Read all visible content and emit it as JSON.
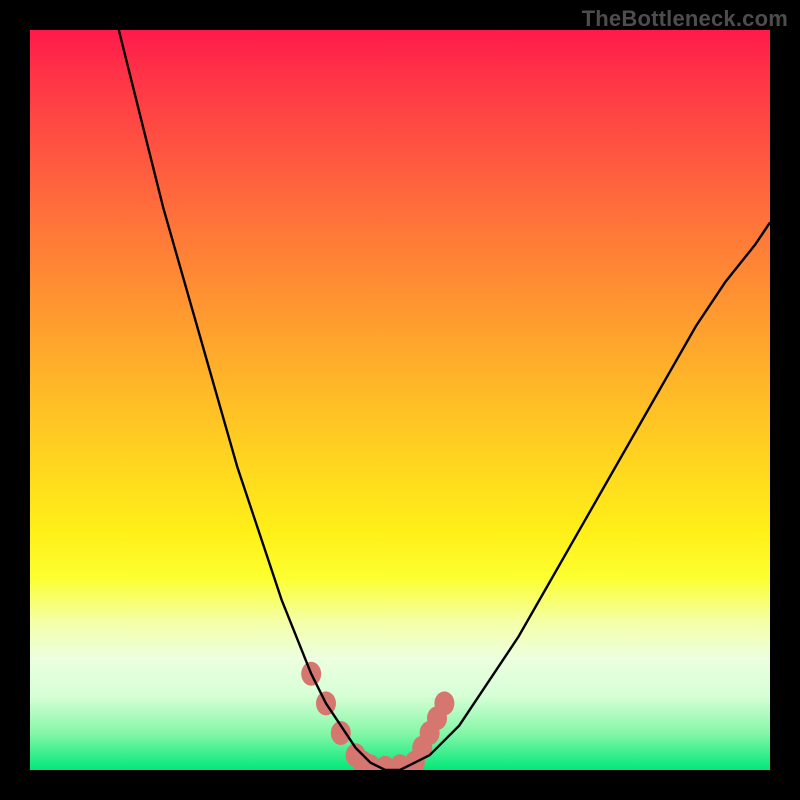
{
  "watermark": {
    "text": "TheBottleneck.com"
  },
  "colors": {
    "frame": "#000000",
    "gradient_top": "#ff1a4b",
    "gradient_mid": "#ffd420",
    "gradient_bottom": "#00e879",
    "curve": "#000000",
    "marker": "#d6776f"
  },
  "chart_data": {
    "type": "line",
    "title": "",
    "xlabel": "",
    "ylabel": "",
    "xlim": [
      0,
      100
    ],
    "ylim": [
      0,
      100
    ],
    "grid": false,
    "legend": false,
    "series": [
      {
        "name": "bottleneck-curve",
        "x": [
          12,
          14,
          16,
          18,
          20,
          22,
          24,
          26,
          28,
          30,
          32,
          34,
          36,
          38,
          40,
          42,
          44,
          46,
          48,
          50,
          54,
          58,
          62,
          66,
          70,
          74,
          78,
          82,
          86,
          90,
          94,
          98,
          100
        ],
        "y": [
          100,
          92,
          84,
          76,
          69,
          62,
          55,
          48,
          41,
          35,
          29,
          23,
          18,
          13,
          9,
          6,
          3,
          1,
          0,
          0,
          2,
          6,
          12,
          18,
          25,
          32,
          39,
          46,
          53,
          60,
          66,
          71,
          74
        ]
      }
    ],
    "markers": {
      "name": "highlight-cluster",
      "shape": "rounded",
      "color": "#d6776f",
      "points": [
        {
          "x": 38,
          "y": 13
        },
        {
          "x": 40,
          "y": 9
        },
        {
          "x": 42,
          "y": 5
        },
        {
          "x": 44,
          "y": 2
        },
        {
          "x": 45,
          "y": 1
        },
        {
          "x": 46,
          "y": 0.5
        },
        {
          "x": 48,
          "y": 0.3
        },
        {
          "x": 50,
          "y": 0.5
        },
        {
          "x": 52,
          "y": 1
        },
        {
          "x": 53,
          "y": 3
        },
        {
          "x": 54,
          "y": 5
        },
        {
          "x": 55,
          "y": 7
        },
        {
          "x": 56,
          "y": 9
        }
      ]
    }
  }
}
